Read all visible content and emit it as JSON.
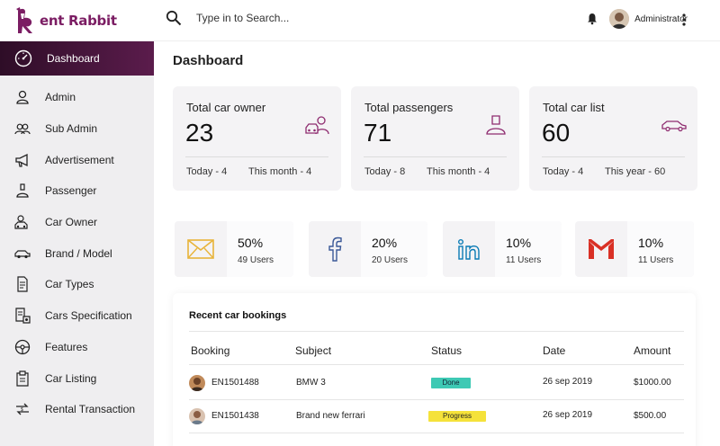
{
  "brand": {
    "name": "ent Rabbit",
    "accent": "#7b1d63"
  },
  "search": {
    "placeholder": "Type in to Search..."
  },
  "user": {
    "name": "Administrator"
  },
  "sidebar": {
    "active": {
      "label": "Dashboard",
      "icon": "dashboard-gauge-icon"
    },
    "items": [
      {
        "label": "Admin",
        "icon": "user-icon"
      },
      {
        "label": "Sub Admin",
        "icon": "users-icon"
      },
      {
        "label": "Advertisement",
        "icon": "megaphone-icon"
      },
      {
        "label": "Passenger",
        "icon": "passenger-icon"
      },
      {
        "label": "Car Owner",
        "icon": "car-owner-icon"
      },
      {
        "label": "Brand / Model",
        "icon": "car-icon"
      },
      {
        "label": "Car Types",
        "icon": "document-icon"
      },
      {
        "label": "Cars Specification",
        "icon": "specification-icon"
      },
      {
        "label": "Features",
        "icon": "steering-wheel-icon"
      },
      {
        "label": "Car Listing",
        "icon": "clipboard-icon"
      },
      {
        "label": "Rental Transaction",
        "icon": "exchange-icon"
      }
    ]
  },
  "main": {
    "title": "Dashboard",
    "stats": [
      {
        "title": "Total car owner",
        "value": "23",
        "left": "Today - 4",
        "right": "This month  -  4",
        "icon": "car-owner-icon"
      },
      {
        "title": "Total passengers",
        "value": "71",
        "left": "Today - 8",
        "right": "This month  -  4",
        "icon": "passenger-icon"
      },
      {
        "title": "Total car list",
        "value": "60",
        "left": "Today - 4",
        "right": "This year  -  60",
        "icon": "car-icon"
      }
    ],
    "social": [
      {
        "network": "email",
        "icon": "mail-icon",
        "percent": "50%",
        "users": "49 Users",
        "color": "#e8b43a"
      },
      {
        "network": "facebook",
        "icon": "facebook-icon",
        "percent": "20%",
        "users": "20 Users",
        "color": "#3b5998"
      },
      {
        "network": "linkedin",
        "icon": "linkedin-icon",
        "percent": "10%",
        "users": "11 Users",
        "color": "#0a7bb5"
      },
      {
        "network": "gmail",
        "icon": "gmail-icon",
        "percent": "10%",
        "users": "11 Users",
        "color": "#d93025"
      }
    ]
  },
  "bookings": {
    "title": "Recent car bookings",
    "columns": [
      "Booking",
      "Subject",
      "Status",
      "Date",
      "Amount"
    ],
    "rows": [
      {
        "booking": "EN1501488",
        "subject": "BMW 3",
        "status": "Done",
        "status_color": "#3ec9b4",
        "date": "26 sep 2019",
        "amount": "$1000.00"
      },
      {
        "booking": "EN1501438",
        "subject": "Brand new ferrari",
        "status": "Progress",
        "status_color": "#f5e23a",
        "date": "26 sep 2019",
        "amount": "$500.00"
      }
    ]
  }
}
